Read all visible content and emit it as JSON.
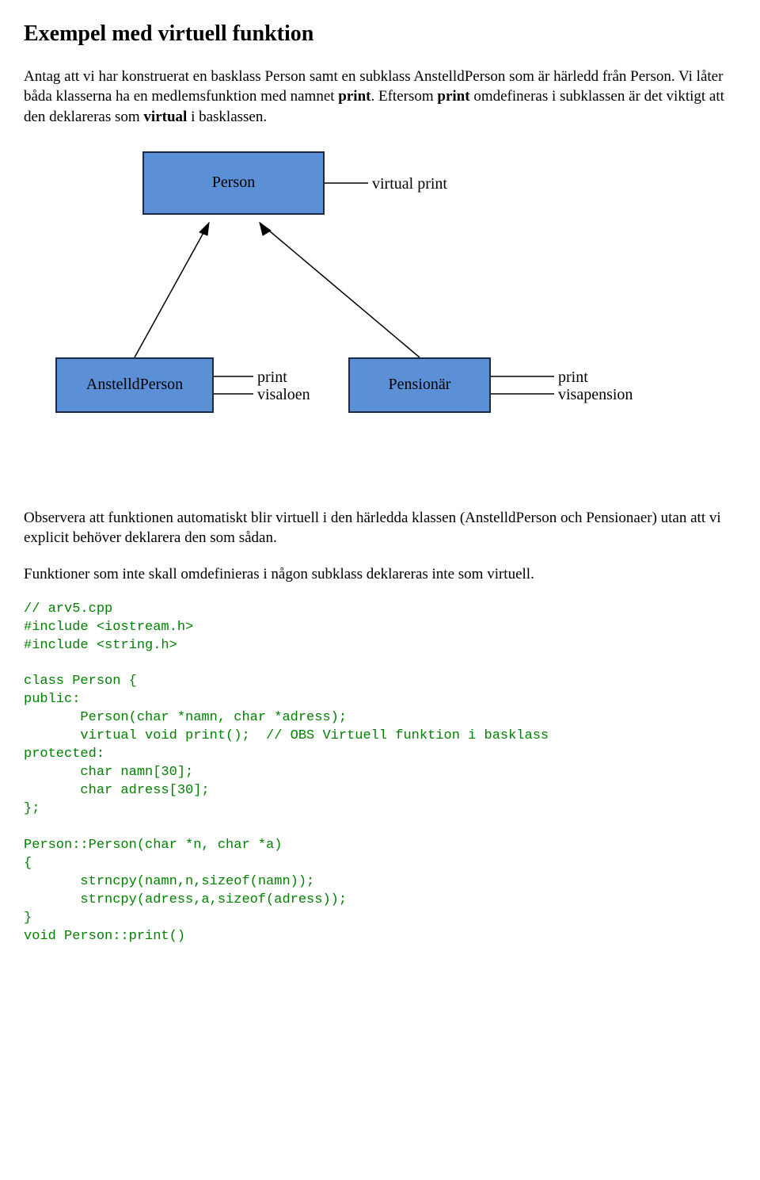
{
  "title": "Exempel med virtuell funktion",
  "para1": {
    "t1": "Antag att vi har konstruerat en basklass Person samt en subklass AnstelldPerson som är härledd från Person. Vi låter båda klasserna ha en medlemsfunktion med namnet ",
    "b1": "print",
    "t2": ". Eftersom ",
    "b2": "print",
    "t3": " omdefineras i subklassen är det viktigt att den deklareras som ",
    "b3": "virtual",
    "t4": " i basklassen."
  },
  "diagram": {
    "person": "Person",
    "person_label": "virtual print",
    "anstelld": "AnstelldPerson",
    "anstelld_l1": "print",
    "anstelld_l2": "visaloen",
    "pensionar": "Pensionär",
    "pensionar_l1": "print",
    "pensionar_l2": "visapension"
  },
  "para2": "Observera att funktionen automatiskt blir virtuell i den härledda klassen (AnstelldPerson och Pensionaer) utan att vi explicit behöver deklarera den som sådan.",
  "para3": "Funktioner som inte skall omdefinieras i någon subklass deklareras inte som virtuell.",
  "code1": "// arv5.cpp\n#include <iostream.h>\n#include <string.h>\n\nclass Person {\npublic:\n       Person(char *namn, char *adress);\n       virtual void print();  // OBS Virtuell funktion i basklass\nprotected:\n       char namn[30];\n       char adress[30];\n};\n\nPerson::Person(char *n, char *a)\n{\n       strncpy(namn,n,sizeof(namn));\n       strncpy(adress,a,sizeof(adress));\n}\nvoid Person::print()"
}
